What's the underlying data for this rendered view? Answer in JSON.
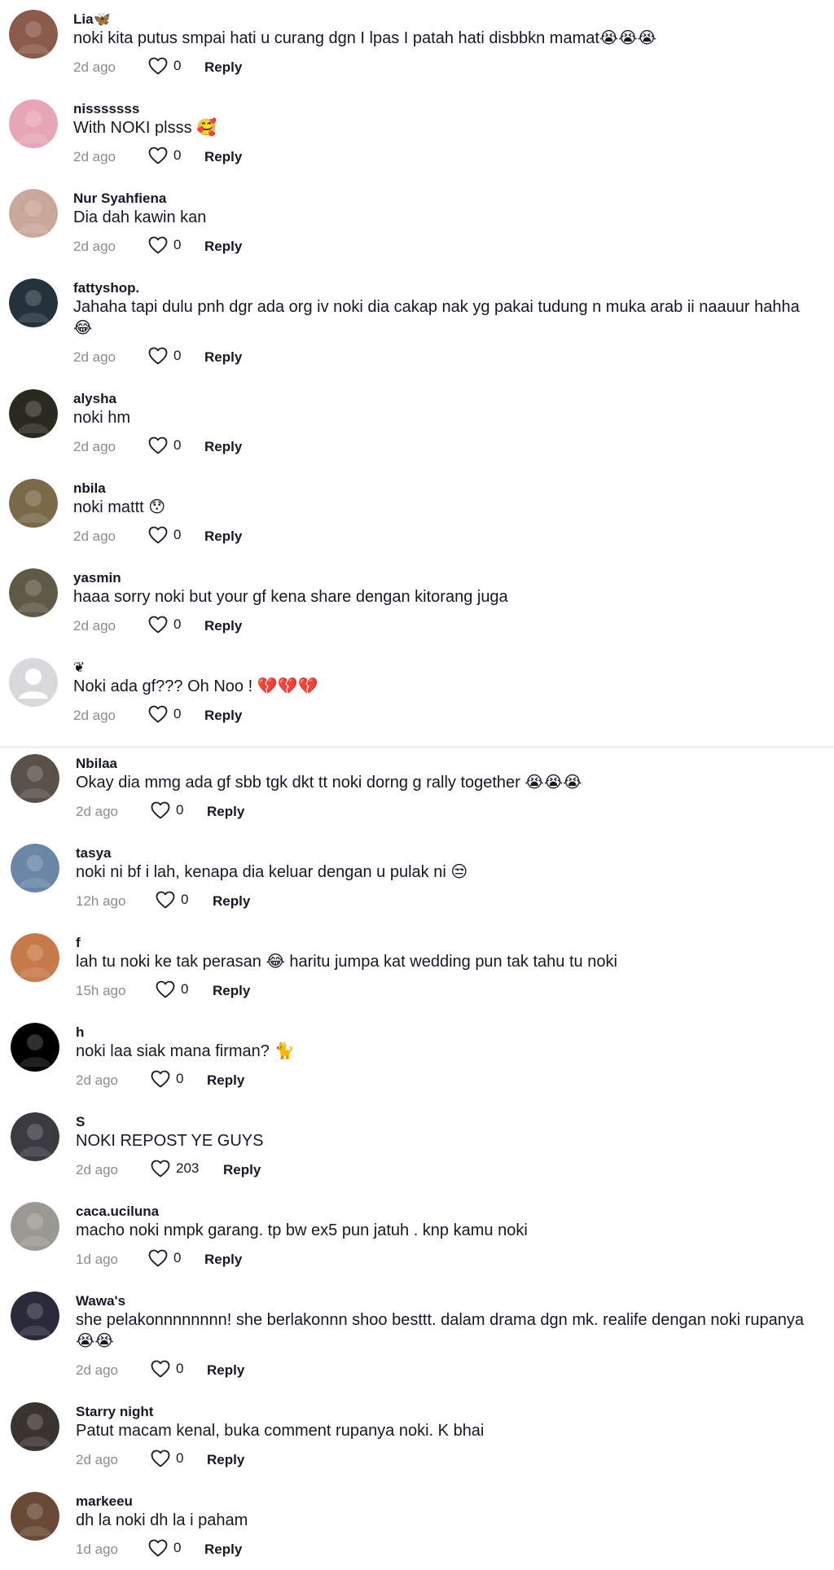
{
  "actions": {
    "reply_label": "Reply"
  },
  "comments": [
    {
      "username": "Lia🦋",
      "text": "noki kita putus smpai hati u curang dgn I lpas I patah hati disbbkn mamat😭😭😭",
      "time": "2d ago",
      "likes": "0",
      "avatar_color": "#8a5a4a"
    },
    {
      "username": "nisssssss",
      "text": "With NOKI plsss 🥰",
      "time": "2d ago",
      "likes": "0",
      "avatar_color": "#e6a6b6"
    },
    {
      "username": "Nur Syahfiena",
      "text": "Dia dah kawin kan",
      "time": "2d ago",
      "likes": "0",
      "avatar_color": "#c9a79a"
    },
    {
      "username": "fattyshop.",
      "text": "Jahaha tapi dulu pnh dgr ada org iv noki dia cakap nak yg pakai tudung n muka arab ii naauur hahha😂",
      "time": "2d ago",
      "likes": "0",
      "avatar_color": "#24323c"
    },
    {
      "username": "alysha",
      "text": "noki hm",
      "time": "2d ago",
      "likes": "0",
      "avatar_color": "#2b2a1e"
    },
    {
      "username": "nbila",
      "text": "noki mattt 😯",
      "time": "2d ago",
      "likes": "0",
      "avatar_color": "#7a6a4a"
    },
    {
      "username": "yasmin",
      "text": "haaa sorry noki but your gf kena share dengan kitorang juga",
      "time": "2d ago",
      "likes": "0",
      "avatar_color": "#5e5a46"
    },
    {
      "username": "❦",
      "text": "Noki ada gf??? Oh Noo ! 💔💔💔",
      "time": "2d ago",
      "likes": "0",
      "avatar_color": "#d9d9db"
    },
    {
      "username": "Nbilaa",
      "text": "Okay dia mmg ada gf sbb tgk dkt tt noki dorng g rally together 😭😭😭",
      "time": "2d ago",
      "likes": "0",
      "avatar_color": "#5a5048"
    },
    {
      "username": "tasya",
      "text": "noki ni bf i lah, kenapa dia keluar dengan u pulak ni 😒",
      "time": "12h ago",
      "likes": "0",
      "avatar_color": "#6a87a8"
    },
    {
      "username": "f",
      "text": "lah tu noki ke tak perasan 😂 haritu jumpa kat wedding pun tak tahu tu noki",
      "time": "15h ago",
      "likes": "0",
      "avatar_color": "#c77a4a"
    },
    {
      "username": "h",
      "text": "noki laa siak mana firman? 🐈",
      "time": "2d ago",
      "likes": "0",
      "avatar_color": "#000000"
    },
    {
      "username": "S",
      "text": "NOKI REPOST YE GUYS",
      "time": "2d ago",
      "likes": "203",
      "avatar_color": "#3a3a40"
    },
    {
      "username": "caca.uciluna",
      "text": "macho noki nmpk garang. tp bw ex5 pun jatuh . knp kamu noki",
      "time": "1d ago",
      "likes": "0",
      "avatar_color": "#9a9a92"
    },
    {
      "username": "Wawa's",
      "text": "she pelakonnnnnnnn! she berlakonnn shoo besttt. dalam drama dgn mk. realife dengan noki rupanya 😭😭",
      "time": "2d ago",
      "likes": "0",
      "avatar_color": "#2a2a3a"
    },
    {
      "username": "Starry night",
      "text": "Patut macam kenal, buka comment rupanya noki. K bhai",
      "time": "2d ago",
      "likes": "0",
      "avatar_color": "#3a3430"
    },
    {
      "username": "markeeu",
      "text": "dh la noki dh la i paham",
      "time": "1d ago",
      "likes": "0",
      "avatar_color": "#6a4a36"
    }
  ]
}
